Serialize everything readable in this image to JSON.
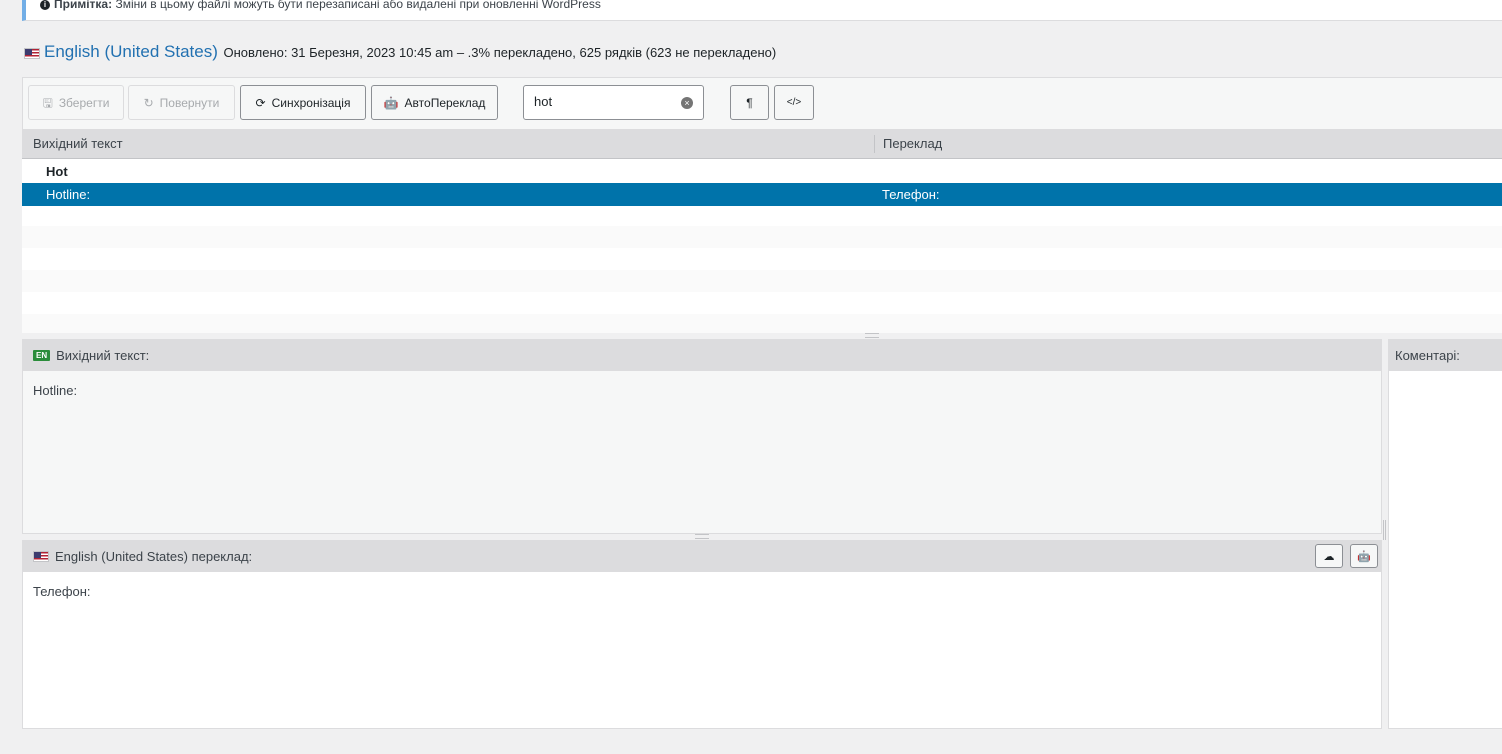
{
  "notice": {
    "label": "Примітка:",
    "text": "Зміни в цьому файлі можуть бути перезаписані або видалені при оновленні WordPress"
  },
  "heading": {
    "language": "English (United States)",
    "meta": "Оновлено: 31 Березня, 2023 10:45 am – .3% перекладено, 625 рядків (623 не перекладено)"
  },
  "toolbar": {
    "save_label": "Зберегти",
    "revert_label": "Повернути",
    "sync_label": "Синхронізація",
    "auto_label": "АвтоПереклад",
    "search_value": "hot",
    "pilcrow_label": "¶",
    "code_label": "</>"
  },
  "grid": {
    "col_source": "Вихідний текст",
    "col_translation": "Переклад",
    "rows": [
      {
        "source": "Hot",
        "translation": ""
      },
      {
        "source": "Hotline:",
        "translation": "Телефон:"
      }
    ]
  },
  "source_pane": {
    "badge": "EN",
    "title": "Вихідний текст:",
    "text": "Hotline:"
  },
  "translation_pane": {
    "title": "English (United States) переклад:",
    "text": "Телефон:"
  },
  "comments_pane": {
    "title": "Коментарі:"
  },
  "colors": {
    "accent": "#2271b1",
    "selected_row": "#0073aa",
    "badge": "#2a8c3a"
  }
}
